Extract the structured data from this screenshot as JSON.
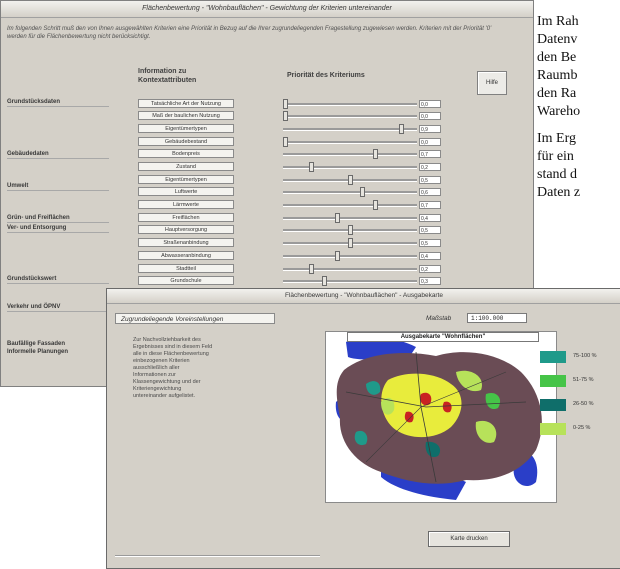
{
  "criteria_window": {
    "title": "Flächenbewertung - \"Wohnbauflächen\" - Gewichtung der Kriterien untereinander",
    "intro": "Im folgenden Schritt muß den von Ihnen ausgewählten Kriterien eine Priorität in Bezug auf die Ihrer zugrundeliegenden Fragestellung zugewiesen werden. Kriterien mit der Priorität '0' werden für die Flächenbewertung nicht berücksichtigt.",
    "column_info": "Information zu\nKontextattributen",
    "column_priority": "Priorität des Kriteriums",
    "help_label": "Hilfe",
    "groups": [
      {
        "label": "Grundstücksdaten"
      },
      {
        "label": "Gebäudedaten"
      },
      {
        "label": "Umwelt"
      },
      {
        "label": "Grün- und Freiflächen"
      },
      {
        "label": "Ver- und Entsorgung"
      },
      {
        "label": "Grundstückswert"
      },
      {
        "label": "Verkehr und ÖPNV"
      },
      {
        "label": "Baufällige Fassaden"
      },
      {
        "label": "Informelle Planungen"
      }
    ],
    "criteria": [
      {
        "label": "Tatsächliche Art der Nutzung",
        "value": "0,0"
      },
      {
        "label": "Maß der baulichen Nutzung",
        "value": "0,0"
      },
      {
        "label": "Eigentümertypen",
        "value": "0,9"
      },
      {
        "label": "Gebäudebestand",
        "value": "0,0"
      },
      {
        "label": "Bodenpreis",
        "value": "0,7"
      },
      {
        "label": "Zustand",
        "value": "0,2"
      },
      {
        "label": "Eigentümertypen",
        "value": "0,5"
      },
      {
        "label": "Luftwerte",
        "value": "0,6"
      },
      {
        "label": "Lärmwerte",
        "value": "0,7"
      },
      {
        "label": "Freiflächen",
        "value": "0,4"
      },
      {
        "label": "Hauptversorgung",
        "value": "0,5"
      },
      {
        "label": "Straßenanbindung",
        "value": "0,5"
      },
      {
        "label": "Abwasseranbindung",
        "value": "0,4"
      },
      {
        "label": "Stadtteil",
        "value": "0,2"
      },
      {
        "label": "Grundschule",
        "value": "0,3"
      }
    ]
  },
  "output_window": {
    "title": "Flächenbewertung - \"Wohnbauflächen\" - Ausgabekarte",
    "panel_heading": "Zugrundeliegende Voreinstellungen",
    "description": "Zur Nachvollziehbarkeit des Ergebnisses sind in diesem Feld alle in diese Flächenbewertung einbezogenen Kriterien ausschließlich aller Informationen zur Klassengewichtung und der Kriteriengewichtung untereinander aufgelistet.",
    "scale_label": "Maßstab",
    "scale_value": "1:100.000",
    "map_title": "Ausgabekarte \"Wohnflächen\"",
    "legend": [
      {
        "label": "75-100 %",
        "color": "#1f9a8a"
      },
      {
        "label": "51-75 %",
        "color": "#46c448"
      },
      {
        "label": "26-50 %",
        "color": "#0f6e6a"
      },
      {
        "label": "0-25 %",
        "color": "#b7e25a"
      }
    ],
    "print_label": "Karte drucken"
  },
  "document_lines_top": [
    "Im Rah",
    "Datenv",
    "den Be",
    "Raumb",
    "den Ra",
    "Wareho"
  ],
  "document_lines_bottom": [
    "Im Erg",
    "für ein",
    "stand d",
    "Daten z"
  ]
}
